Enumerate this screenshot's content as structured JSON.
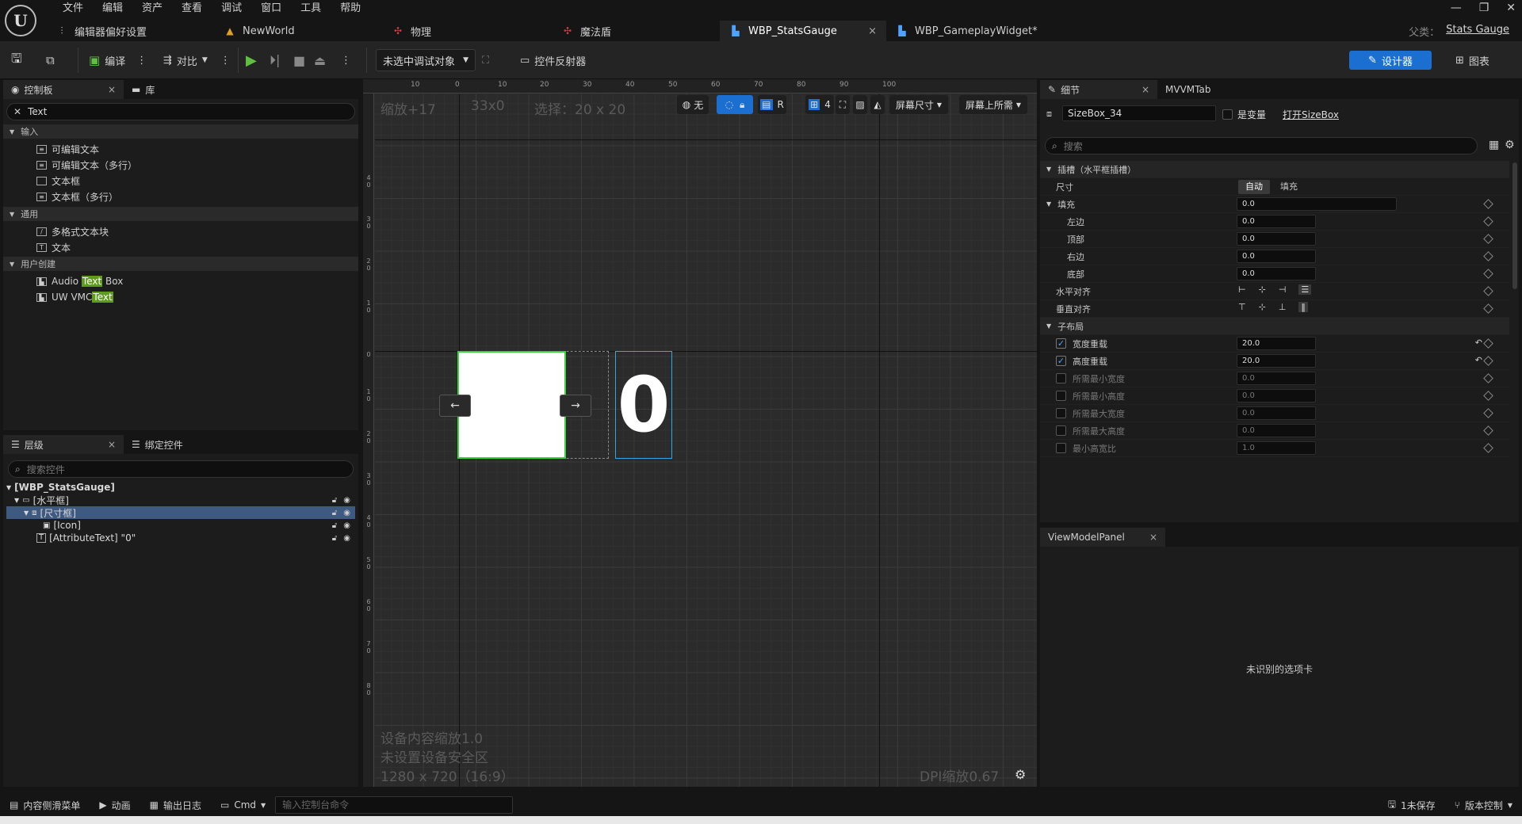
{
  "title_bar": {
    "menu": [
      "文件",
      "编辑",
      "资产",
      "查看",
      "调试",
      "窗口",
      "工具",
      "帮助"
    ],
    "doc_tabs": [
      {
        "label": "编辑器偏好设置",
        "icon": "settings-sliders-icon"
      },
      {
        "label": "NewWorld",
        "icon": "level-icon"
      },
      {
        "label": "物理",
        "icon": "physics-asset-icon"
      },
      {
        "label": "魔法盾",
        "icon": "physics-asset-icon"
      },
      {
        "label": "WBP_StatsGauge",
        "icon": "widget-blueprint-icon",
        "active": true
      },
      {
        "label": "WBP_GameplayWidget*",
        "icon": "widget-blueprint-icon"
      }
    ],
    "parent_class_label": "父类：",
    "parent_class_value": "Stats Gauge"
  },
  "toolbar": {
    "compile": "编译",
    "diff": "对比",
    "debug_object": "未选中调试对象",
    "widget_reflector": "控件反射器",
    "designer": "设计器",
    "graph": "图表"
  },
  "palette": {
    "tabs": [
      "控制板",
      "库"
    ],
    "search_value": "Text",
    "categories": [
      {
        "name": "输入",
        "items": [
          "可编辑文本",
          "可编辑文本（多行）",
          "文本框",
          "文本框（多行）"
        ]
      },
      {
        "name": "通用",
        "items": [
          "多格式文本块",
          "文本"
        ]
      },
      {
        "name": "用户创建",
        "items": []
      }
    ],
    "user_items": [
      {
        "pre": "Audio ",
        "hl": "Text",
        "post": " Box"
      },
      {
        "pre": "UW VMC",
        "hl": "Text",
        "post": ""
      }
    ]
  },
  "hierarchy": {
    "tabs": [
      "层级",
      "绑定控件"
    ],
    "search_placeholder": "搜索控件",
    "rows": [
      "[WBP_StatsGauge]",
      "[水平框]",
      "[尺寸框]",
      "[Icon]",
      "[AttributeText] \"0\""
    ]
  },
  "viewport": {
    "zoom": "缩放+17",
    "size": "33x0",
    "selection": "选择：20 x 20",
    "none_label": "无",
    "r_label": "R",
    "grid_count": "4",
    "screen_size": "屏幕尺寸",
    "fill_screen": "屏幕上所需",
    "device_scale": "设备内容缩放1.0",
    "safe_zone": "未设置设备安全区",
    "resolution": "1280 x 720（16:9）",
    "dpi": "DPI缩放0.67",
    "text_preview": "0",
    "ruler_top": [
      "10",
      "0",
      "10",
      "20",
      "30",
      "40",
      "50",
      "60",
      "70",
      "80",
      "90",
      "100"
    ],
    "ruler_left": [
      "4 0",
      "3 0",
      "2 0",
      "1 0",
      "0",
      "1 0",
      "2 0",
      "3 0",
      "4 0",
      "5 0",
      "6 0",
      "7 0",
      "8 0"
    ]
  },
  "details": {
    "tabs": [
      "细节",
      "MVVMTab"
    ],
    "name_value": "SizeBox_34",
    "is_variable": "是变量",
    "open_link": "打开SizeBox",
    "search_placeholder": "搜索",
    "slot_section": "插槽（水平框插槽）",
    "size_label": "尺寸",
    "size_auto": "自动",
    "size_fill": "填充",
    "padding_label": "填充",
    "padding_value": "0.0",
    "padding_rows": [
      {
        "label": "左边",
        "value": "0.0"
      },
      {
        "label": "顶部",
        "value": "0.0"
      },
      {
        "label": "右边",
        "value": "0.0"
      },
      {
        "label": "底部",
        "value": "0.0"
      }
    ],
    "h_align": "水平对齐",
    "v_align": "垂直对齐",
    "child_layout": "子布局",
    "child_rows": [
      {
        "label": "宽度重载",
        "value": "20.0",
        "checked": true
      },
      {
        "label": "高度重载",
        "value": "20.0",
        "checked": true
      },
      {
        "label": "所需最小宽度",
        "value": "0.0",
        "checked": false
      },
      {
        "label": "所需最小高度",
        "value": "0.0",
        "checked": false
      },
      {
        "label": "所需最大宽度",
        "value": "0.0",
        "checked": false
      },
      {
        "label": "所需最大高度",
        "value": "0.0",
        "checked": false
      },
      {
        "label": "最小高宽比",
        "value": "1.0",
        "checked": false
      }
    ]
  },
  "viewmodel": {
    "tab": "ViewModelPanel",
    "message": "未识别的选项卡"
  },
  "status_bar": {
    "content_drawer": "内容侧滑菜单",
    "animation": "动画",
    "output_log": "输出日志",
    "cmd": "Cmd",
    "console_placeholder": "输入控制台命令",
    "unsaved": "1未保存",
    "source_control": "版本控制"
  },
  "colors": {
    "accent": "#1a6fd1",
    "selection": "#3e5a80",
    "highlight": "#5f9c1a",
    "green_outline": "#3cd23c",
    "cyan_outline": "#30a9e0"
  }
}
